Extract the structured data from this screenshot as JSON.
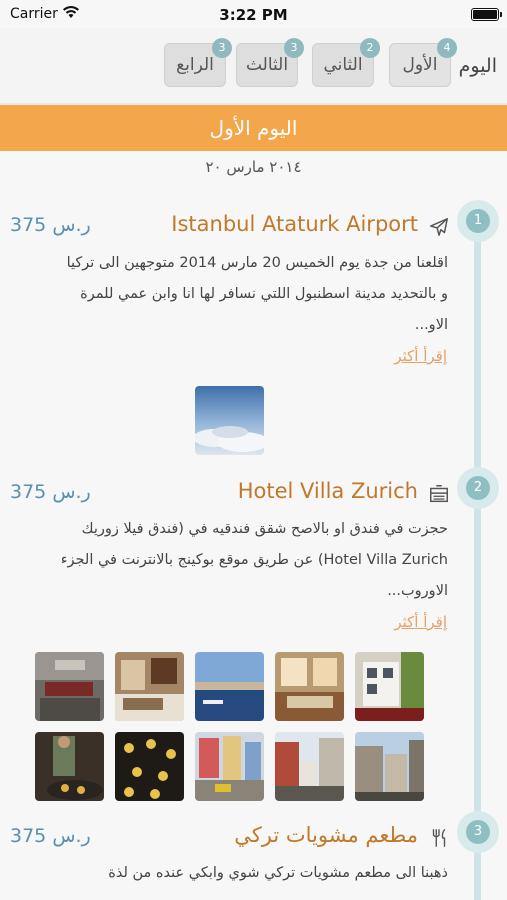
{
  "status_bar": {
    "carrier": "Carrier",
    "time": "3:22 PM"
  },
  "tabs": {
    "label": "اليوم",
    "items": [
      {
        "label": "الأول",
        "badge": "4"
      },
      {
        "label": "الثاني",
        "badge": "2"
      },
      {
        "label": "الثالث",
        "badge": "3"
      },
      {
        "label": "الرابع",
        "badge": "3"
      }
    ]
  },
  "day_header": {
    "title": "اليوم الأول",
    "date": "٢٠١٤ مارس ٢٠"
  },
  "entries": [
    {
      "number": "1",
      "icon": "airplane-icon",
      "title": "Istanbul Ataturk Airport",
      "price": "375 ر.س",
      "lines": [
        "اقلعنا من جدة يوم الخميس 20 مارس 2014 متوجهين الى تركيا",
        "و بالتحديد مدينة اسطنبول اللتي نسافر لها انا وابن عمي للمرة",
        "الاو..."
      ],
      "read_more": "إقرأ أكثر"
    },
    {
      "number": "2",
      "icon": "bed-icon",
      "title": "Hotel Villa Zurich",
      "price": "375 ر.س",
      "lines": [
        "حجزت في فندق او بالاصح شقق فندقيه في (فندق فيلا زوريك",
        "Hotel Villa Zurich) عن طريق موقع بوكينج بالانترنت في الجزء",
        "الاوروب..."
      ],
      "read_more": "إقرأ أكثر"
    },
    {
      "number": "3",
      "icon": "fork-knife-icon",
      "title": "مطعم مشويات تركي",
      "price": "375 ر.س",
      "lines": [
        "ذهبنا الى مطعم مشويات تركي شوي وابكي عنده من لذة"
      ]
    }
  ],
  "colors": {
    "accent_orange": "#f3a64a",
    "title_brown": "#c2782a",
    "price_blue": "#5a8fb0",
    "timeline_teal": "#8fbfc2"
  }
}
